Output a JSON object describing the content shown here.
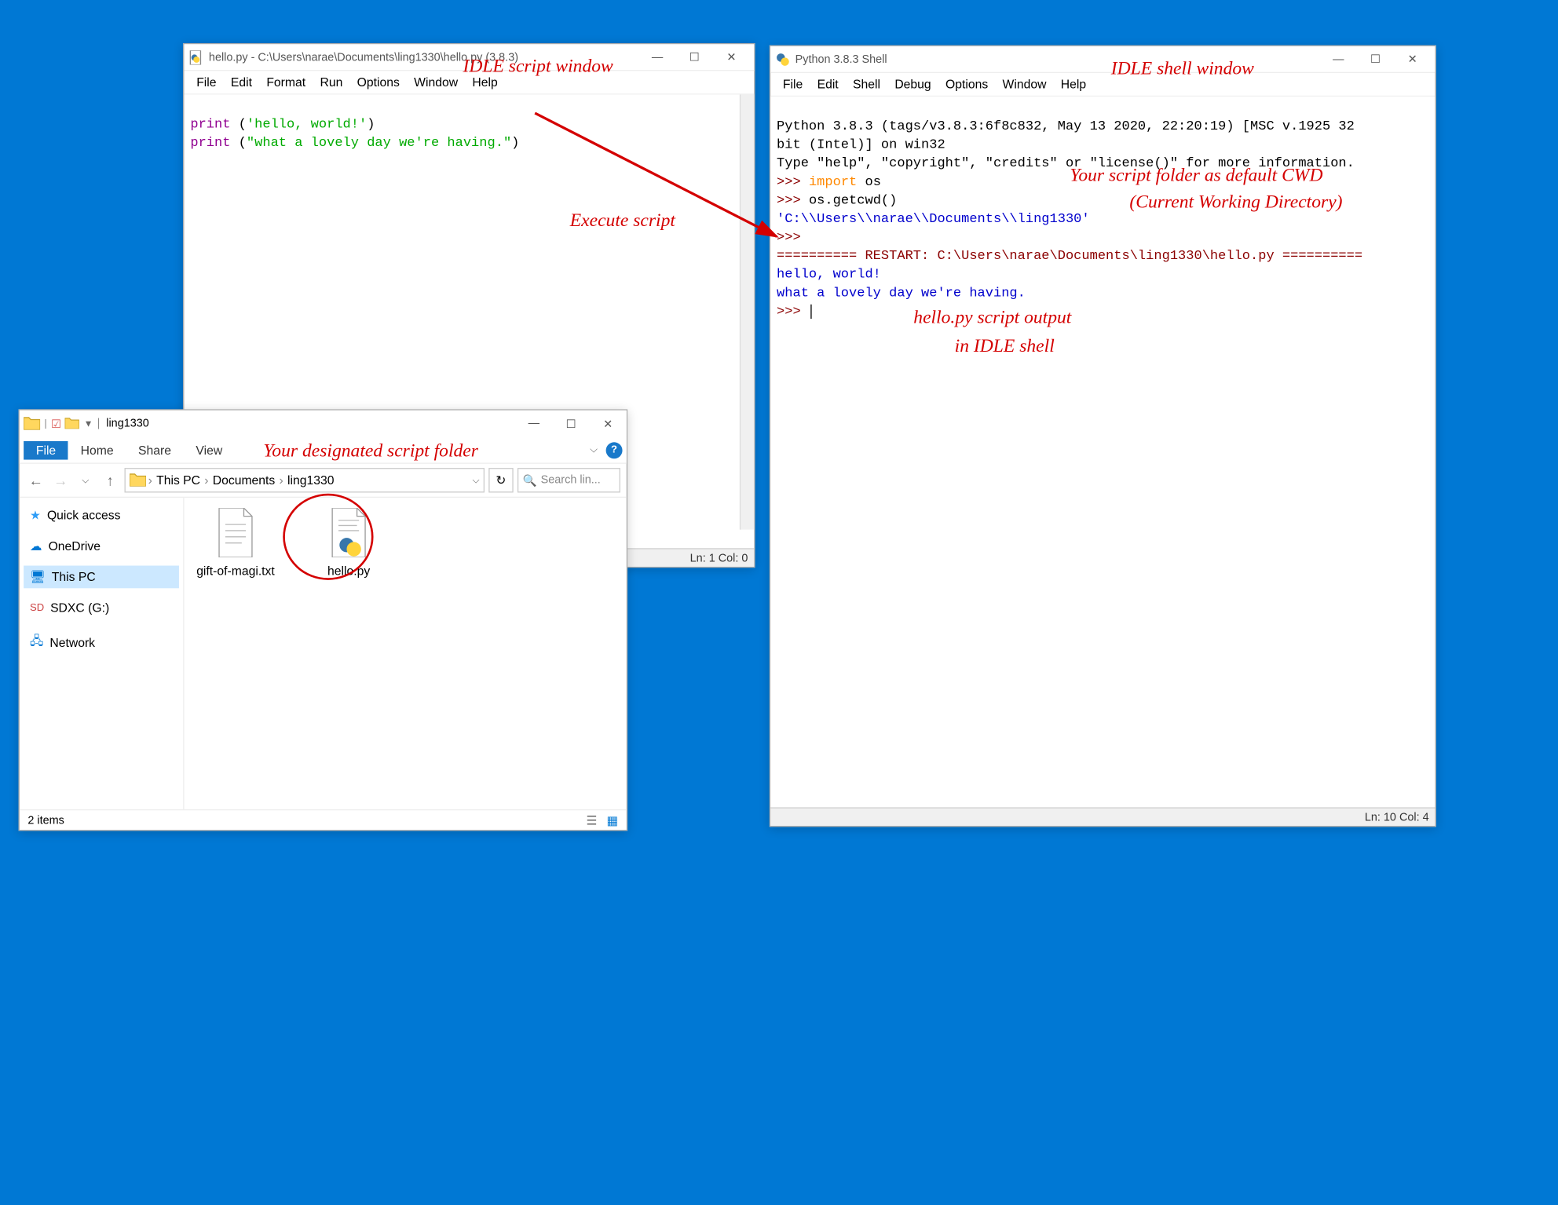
{
  "idle_editor": {
    "title": "hello.py - C:\\Users\\narae\\Documents\\ling1330\\hello.py (3.8.3)",
    "menu": [
      "File",
      "Edit",
      "Format",
      "Run",
      "Options",
      "Window",
      "Help"
    ],
    "code_lines": [
      {
        "builtin": "print",
        "plain1": " (",
        "str": "'hello, world!'",
        "plain2": ")"
      },
      {
        "builtin": "print",
        "plain1": " (",
        "str": "\"what a lovely day we're having.\"",
        "plain2": ")"
      }
    ],
    "status": "Ln: 1  Col: 0"
  },
  "idle_shell": {
    "title": "Python 3.8.3 Shell",
    "menu": [
      "File",
      "Edit",
      "Shell",
      "Debug",
      "Options",
      "Window",
      "Help"
    ],
    "banner_line1": "Python 3.8.3 (tags/v3.8.3:6f8c832, May 13 2020, 22:20:19) [MSC v.1925 32",
    "banner_line2": "bit (Intel)] on win32",
    "banner_line3": "Type \"help\", \"copyright\", \"credits\" or \"license()\" for more information.",
    "prompt": ">>> ",
    "import_kw": "import",
    "import_mod": " os",
    "getcwd_call": "os.getcwd()",
    "cwd_result": "'C:\\\\Users\\\\narae\\\\Documents\\\\ling1330'",
    "restart_line": "========== RESTART: C:\\Users\\narae\\Documents\\ling1330\\hello.py ==========",
    "output1": "hello, world!",
    "output2": "what a lovely day we're having.",
    "status": "Ln: 10  Col: 4"
  },
  "explorer": {
    "title": "ling1330",
    "tabs": [
      "File",
      "Home",
      "Share",
      "View"
    ],
    "breadcrumb": [
      "This PC",
      "Documents",
      "ling1330"
    ],
    "search_placeholder": "Search lin...",
    "nav_items": [
      {
        "label": "Quick access",
        "icon": "star"
      },
      {
        "label": "OneDrive",
        "icon": "cloud"
      },
      {
        "label": "This PC",
        "icon": "pc",
        "selected": true
      },
      {
        "label": "SDXC (G:)",
        "icon": "sd"
      },
      {
        "label": "Network",
        "icon": "network"
      }
    ],
    "files": [
      {
        "name": "gift-of-magi.txt",
        "type": "txt"
      },
      {
        "name": "hello.py",
        "type": "py",
        "circled": true
      }
    ],
    "status": "2 items"
  },
  "annotations": {
    "script_window": "IDLE script window",
    "shell_window": "IDLE shell window",
    "execute": "Execute script",
    "cwd1": "Your script folder as default CWD",
    "cwd2": "(Current Working Directory)",
    "output1": "hello.py script output",
    "output2": "in IDLE shell",
    "folder": "Your designated script folder"
  }
}
